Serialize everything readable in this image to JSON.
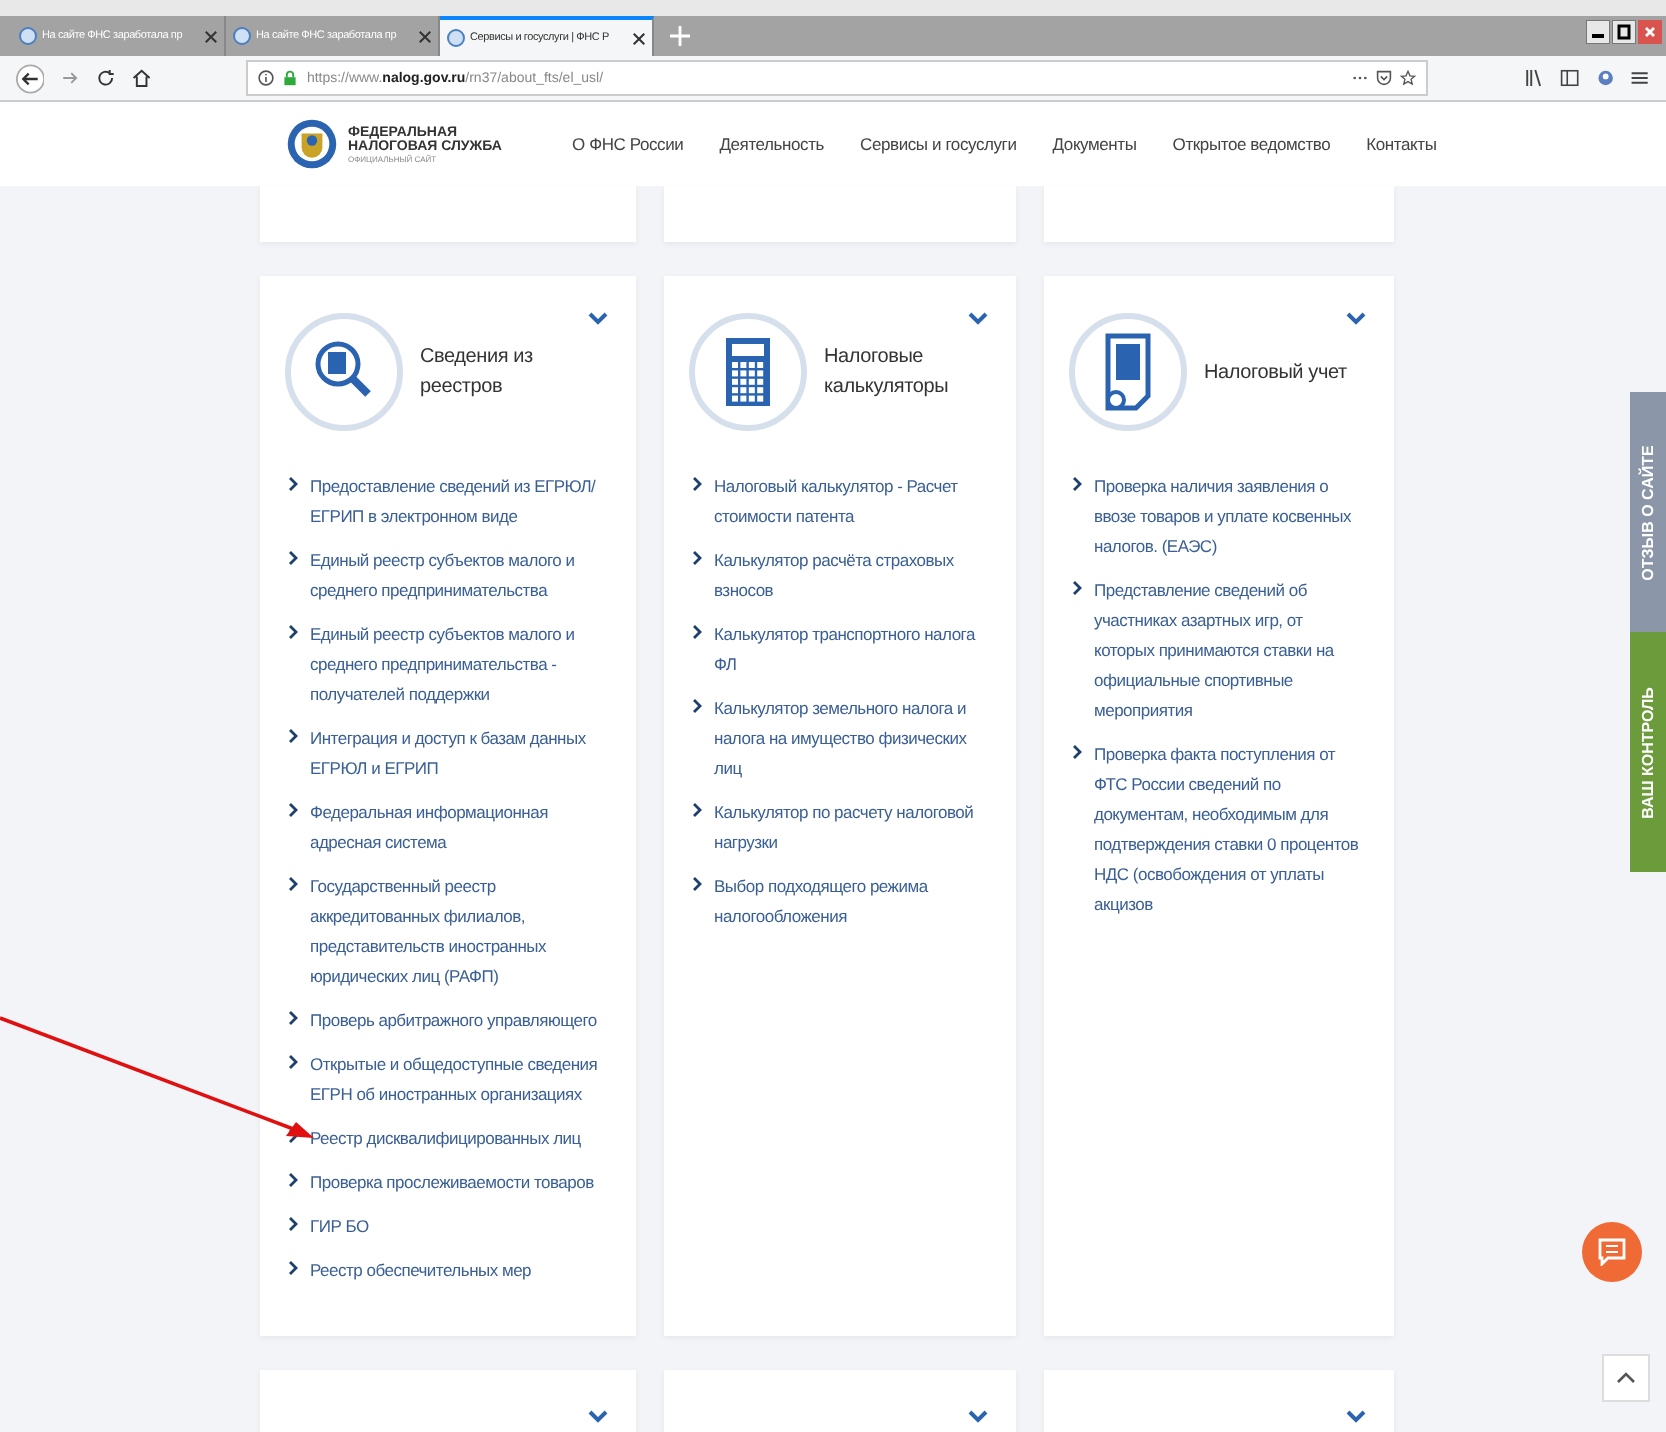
{
  "browser": {
    "tabs": [
      {
        "title": "На сайте ФНС заработала пр",
        "selected": false
      },
      {
        "title": "На сайте ФНС заработала пр",
        "selected": false
      },
      {
        "title": "Сервисы и госуслуги | ФНС Р",
        "selected": true
      }
    ],
    "address_bar": {
      "url": "https://www.**nalog.gov.ru**/rn37/about_fts/el_usl/"
    }
  },
  "site": {
    "logo": {
      "line1": "ФЕДЕРАЛЬНАЯ",
      "line2": "НАЛОГОВАЯ СЛУЖБА",
      "subtitle": "ОФИЦИАЛЬНЫЙ САЙТ"
    },
    "nav": [
      "О ФНС России",
      "Деятельность",
      "Сервисы и госуслуги",
      "Документы",
      "Открытое ведомство",
      "Контакты"
    ]
  },
  "cards": [
    {
      "kind": "search",
      "title": "Сведения из реестров",
      "items": [
        "Предоставление сведений из ЕГРЮЛ/ЕГРИП в электронном виде",
        "Единый реестр субъектов малого и среднего предпринимательства",
        "Единый реестр субъектов малого и среднего предпринимательства - получателей поддержки",
        "Интеграция и доступ к базам данных ЕГРЮЛ и ЕГРИП",
        "Федеральная информационная адресная система",
        "Государственный реестр аккредитованных филиалов, представительств иностранных юридических лиц (РАФП)",
        "Проверь арбитражного управляющего",
        "Открытые и общедоступные сведения ЕГРН об иностранных организациях",
        "Реестр дисквалифицированных лиц",
        "Проверка прослеживаемости товаров",
        "ГИР БО",
        "Реестр обеспечительных мер"
      ]
    },
    {
      "kind": "calculator",
      "title": "Налоговые калькуляторы",
      "items": [
        "Налоговый калькулятор - Расчет стоимости патента",
        "Калькулятор расчёта страховых взносов",
        "Калькулятор транспортного налога ФЛ",
        "Калькулятор земельного налога и налога на имущество физических лиц",
        "Калькулятор по расчету налоговой нагрузки",
        "Выбор подходящего режима налогообложения"
      ]
    },
    {
      "kind": "document",
      "title": "Налоговый учет",
      "items": [
        "Проверка наличия заявления о ввозе товаров и уплате косвенных налогов. (ЕАЭС)",
        "Представление сведений об участниках азартных игр, от которых принимаются ставки на официальные спортивные мероприятия",
        "Проверка факта поступления от ФТС России сведений по документам, необходимым для подтверждения ставки 0 процентов НДС (освобождения от уплаты акцизов"
      ]
    }
  ],
  "side_tabs": [
    {
      "label": "ОТЗЫВ О САЙТЕ",
      "color": "#8b97a8"
    },
    {
      "label": "ВАШ КОНТРОЛЬ",
      "color": "#6b9b3a"
    }
  ]
}
